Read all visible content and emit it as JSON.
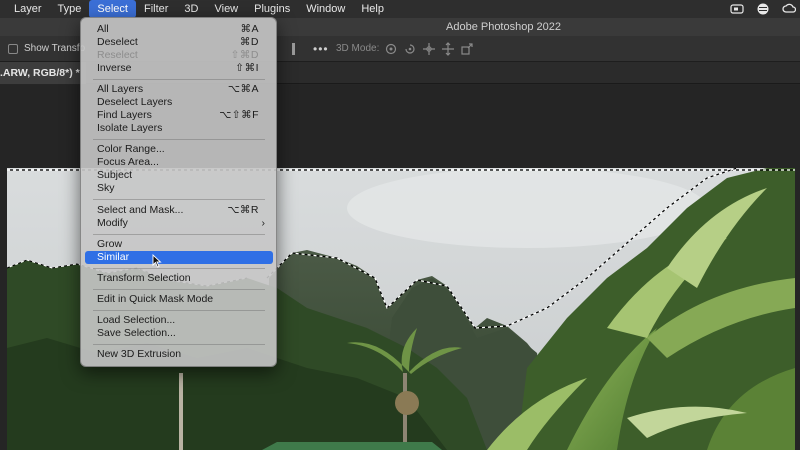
{
  "menubar": {
    "items": [
      "Layer",
      "Type",
      "Select",
      "Filter",
      "3D",
      "View",
      "Plugins",
      "Window",
      "Help"
    ],
    "active_index": 2,
    "right_icons": [
      "video-camera-icon",
      "control-center-icon",
      "creative-cloud-icon"
    ]
  },
  "titlebar": {
    "title": "Adobe Photoshop 2022"
  },
  "options_bar": {
    "show_transform": "Show Transfo",
    "mode_3d": "3D Mode:",
    "more": "•••"
  },
  "document": {
    "tab_label": ".ARW, RGB/8*) *"
  },
  "select_menu": {
    "groups": [
      [
        {
          "label": "All",
          "shortcut": "⌘A"
        },
        {
          "label": "Deselect",
          "shortcut": "⌘D"
        },
        {
          "label": "Reselect",
          "shortcut": "⇧⌘D",
          "disabled": true
        },
        {
          "label": "Inverse",
          "shortcut": "⇧⌘I"
        }
      ],
      [
        {
          "label": "All Layers",
          "shortcut": "⌥⌘A"
        },
        {
          "label": "Deselect Layers",
          "shortcut": ""
        },
        {
          "label": "Find Layers",
          "shortcut": "⌥⇧⌘F"
        },
        {
          "label": "Isolate Layers",
          "shortcut": ""
        }
      ],
      [
        {
          "label": "Color Range...",
          "shortcut": ""
        },
        {
          "label": "Focus Area...",
          "shortcut": ""
        },
        {
          "label": "Subject",
          "shortcut": ""
        },
        {
          "label": "Sky",
          "shortcut": ""
        }
      ],
      [
        {
          "label": "Select and Mask...",
          "shortcut": "⌥⌘R"
        },
        {
          "label": "Modify",
          "shortcut": "",
          "submenu": true
        }
      ],
      [
        {
          "label": "Grow",
          "shortcut": ""
        },
        {
          "label": "Similar",
          "shortcut": "",
          "highlighted": true
        }
      ],
      [
        {
          "label": "Transform Selection",
          "shortcut": ""
        }
      ],
      [
        {
          "label": "Edit in Quick Mask Mode",
          "shortcut": ""
        }
      ],
      [
        {
          "label": "Load Selection...",
          "shortcut": ""
        },
        {
          "label": "Save Selection...",
          "shortcut": ""
        }
      ],
      [
        {
          "label": "New 3D Extrusion",
          "shortcut": ""
        }
      ]
    ],
    "submenu_arrow": "›"
  },
  "colors": {
    "accent": "#2f6fe5",
    "menubar_active": "#3b6fd6",
    "menu_bg": "#c6c6c6"
  }
}
